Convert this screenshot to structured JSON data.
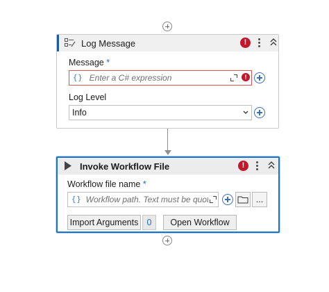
{
  "log_message": {
    "title": "Log Message",
    "message_label": "Message",
    "required_mark": "*",
    "message_brace": "{}",
    "message_placeholder": "Enter a C# expression",
    "log_level_label": "Log Level",
    "log_level_value": "Info",
    "error_glyph": "!"
  },
  "invoke_workflow": {
    "title": "Invoke Workflow File",
    "file_label": "Workflow file name",
    "required_mark": "*",
    "file_brace": "{}",
    "file_placeholder": "Workflow path. Text must be quote",
    "browse_more_label": "...",
    "import_arguments_label": "Import Arguments",
    "argument_count": "0",
    "open_workflow_label": "Open Workflow",
    "error_glyph": "!"
  },
  "colors": {
    "error": "#c2182b",
    "selection": "#1a73c7",
    "header_accent": "#1f5aa8",
    "add_icon": "#3a6fb7"
  },
  "icons": [
    "add-activity-icon",
    "log-message-icon",
    "play-icon",
    "error-icon",
    "more-options-icon",
    "collapse-icon",
    "expand-editor-icon",
    "add-icon",
    "chevron-down-icon",
    "folder-icon"
  ]
}
